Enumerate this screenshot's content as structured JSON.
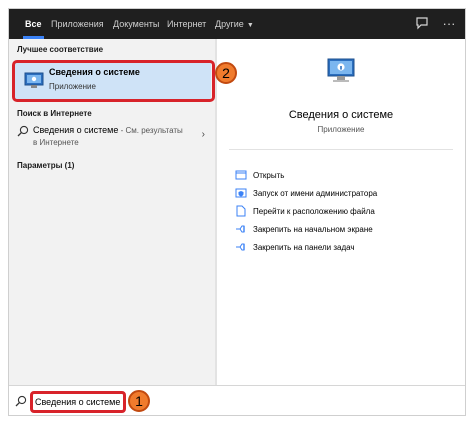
{
  "tabs": [
    {
      "label": "Все",
      "active": true
    },
    {
      "label": "Приложения",
      "active": false
    },
    {
      "label": "Документы",
      "active": false
    },
    {
      "label": "Интернет",
      "active": false
    },
    {
      "label": "Другие",
      "active": false,
      "dropdown": true
    }
  ],
  "top_icons": [
    "feedback-icon",
    "more-icon"
  ],
  "left": {
    "best_match_title": "Лучшее соответствие",
    "best_match": {
      "title": "Сведения о системе",
      "subtitle": "Приложение",
      "icon": "system-info-icon"
    },
    "web_title": "Поиск в Интернете",
    "web_item": {
      "main": "Сведения о системе",
      "suffix": " - См. результаты",
      "line2": "в Интернете"
    },
    "params_title": "Параметры (1)"
  },
  "right": {
    "app_name": "Сведения о системе",
    "app_type": "Приложение",
    "actions": [
      {
        "label": "Открыть",
        "icon": "open-icon"
      },
      {
        "label": "Запуск от имени администратора",
        "icon": "run-as-admin-icon"
      },
      {
        "label": "Перейти к расположению файла",
        "icon": "file-location-icon"
      },
      {
        "label": "Закрепить на начальном экране",
        "icon": "pin-icon"
      },
      {
        "label": "Закрепить на панели задач",
        "icon": "pin-icon"
      }
    ]
  },
  "search": {
    "value": "Сведения о системе"
  },
  "badges": {
    "one": "1",
    "two": "2"
  },
  "colors": {
    "accent": "#3b82f6",
    "highlight": "#cfe3f7",
    "callout_border": "#d8232a",
    "badge": "#f07b2d"
  }
}
